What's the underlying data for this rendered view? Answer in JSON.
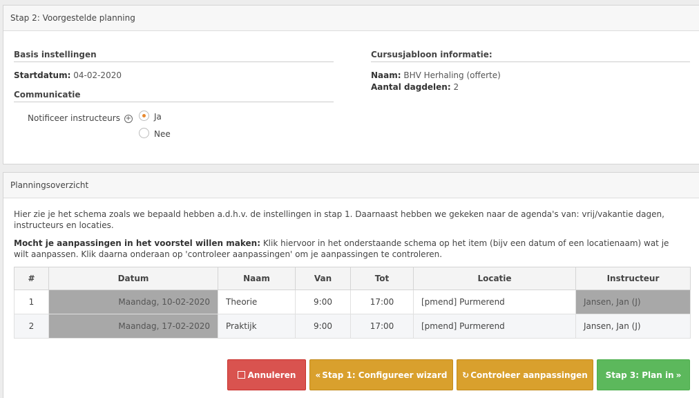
{
  "step2": {
    "title": "Stap 2: Voorgestelde planning",
    "basis_title": "Basis instellingen",
    "startdatum_label": "Startdatum:",
    "startdatum_value": "04-02-2020",
    "communicatie_title": "Communicatie",
    "notificeer_label": "Notificeer instructeurs",
    "radio_ja": "Ja",
    "radio_nee": "Nee",
    "radio_selected": "Ja",
    "template_title": "Cursusjabloon informatie:",
    "naam_label": "Naam:",
    "naam_value": "BHV Herhaling (offerte)",
    "dagdelen_label": "Aantal dagdelen:",
    "dagdelen_value": "2"
  },
  "overview": {
    "title": "Planningsoverzicht",
    "intro": "Hier zie je het schema zoals we bepaald hebben a.d.h.v. de instellingen in stap 1. Daarnaast hebben we gekeken naar de agenda's van: vrij/vakantie dagen, instructeurs en locaties.",
    "hint_bold": "Mocht je aanpassingen in het voorstel willen maken:",
    "hint_text": " Klik hiervoor in het onderstaande schema op het item (bijv een datum of een locatienaam) wat je wilt aanpassen. Klik daarna onderaan op 'controleer aanpassingen' om je aanpassingen te controleren.",
    "columns": [
      "#",
      "Datum",
      "Naam",
      "Van",
      "Tot",
      "Locatie",
      "Instructeur"
    ],
    "rows": [
      {
        "num": "1",
        "datum": "Maandag, 10-02-2020",
        "naam": "Theorie",
        "van": "9:00",
        "tot": "17:00",
        "locatie": "[pmend] Purmerend",
        "instructeur": "Jansen, Jan (J)"
      },
      {
        "num": "2",
        "datum": "Maandag, 17-02-2020",
        "naam": "Praktijk",
        "van": "9:00",
        "tot": "17:00",
        "locatie": "[pmend] Purmerend",
        "instructeur": "Jansen, Jan (J)"
      }
    ]
  },
  "buttons": {
    "cancel": "Annuleren",
    "step1": "Stap 1: Configureer wizard",
    "check": "Controleer aanpassingen",
    "step3": "Stap 3: Plan in"
  },
  "colors": {
    "cancel": "#d9534f",
    "warning": "#d9a02d",
    "success": "#5cb85c",
    "radio_dot": "#e8892f"
  }
}
